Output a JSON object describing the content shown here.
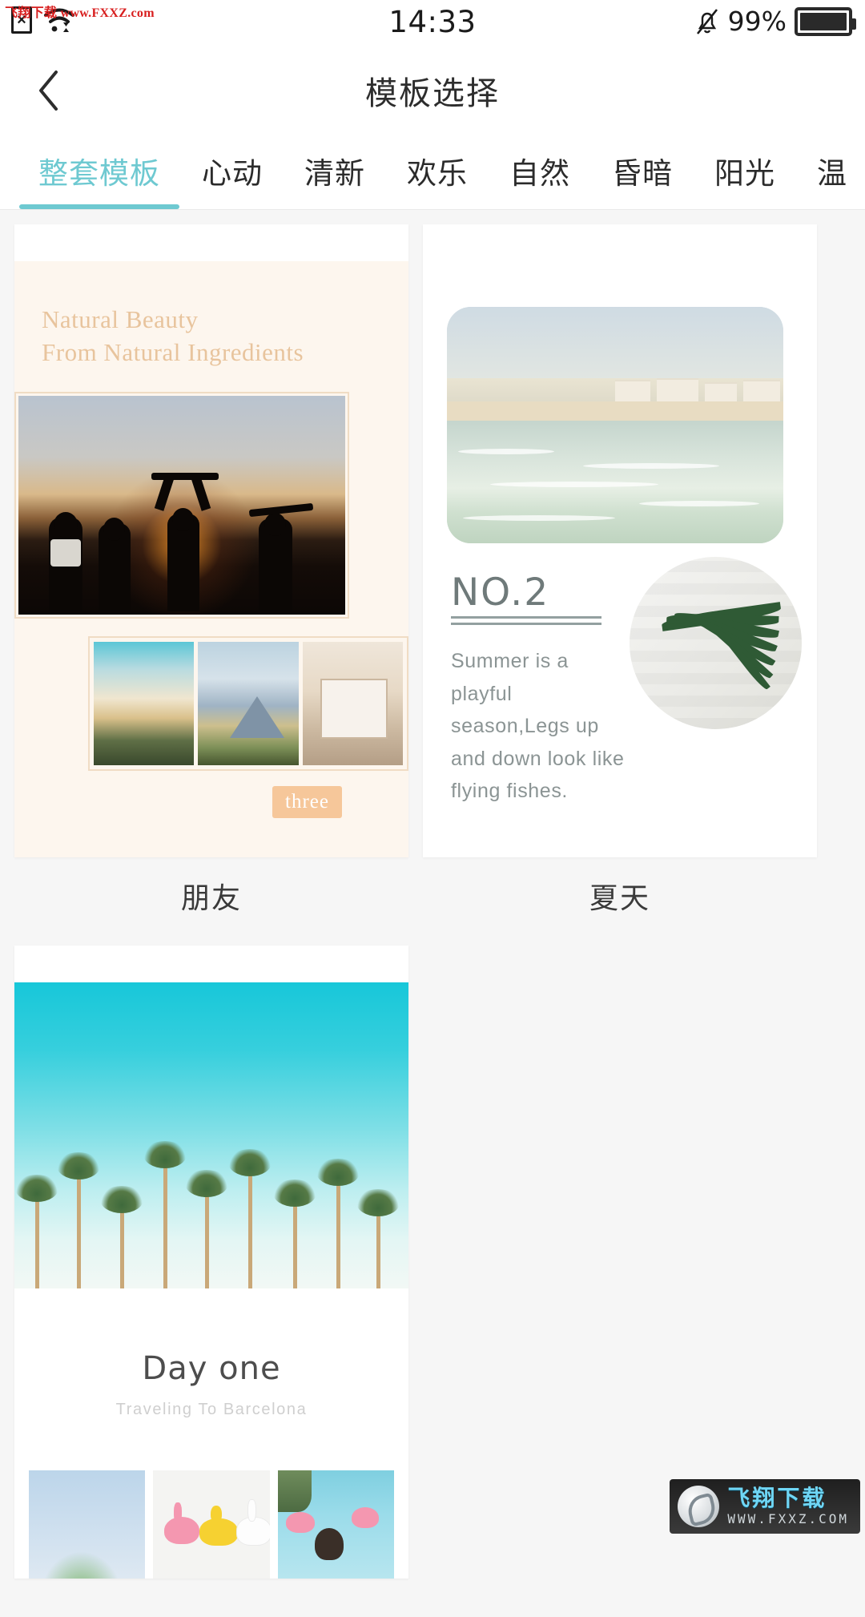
{
  "watermark": {
    "top_text": "飞翔下载 www.FXXZ.com",
    "bottom_cn": "飞翔下载",
    "bottom_en": "WWW.FXXZ.COM"
  },
  "statusbar": {
    "time": "14:33",
    "battery_percent": "99%",
    "sim_glyph": "×",
    "icons": [
      "sim-card-icon",
      "wifi-icon",
      "bell-muted-icon",
      "battery-icon"
    ]
  },
  "header": {
    "title": "模板选择",
    "back_icon": "chevron-left-icon"
  },
  "tabs": {
    "active_index": 0,
    "accent_color": "#6ec9d1",
    "items": [
      {
        "label": "整套模板"
      },
      {
        "label": "心动"
      },
      {
        "label": "清新"
      },
      {
        "label": "欢乐"
      },
      {
        "label": "自然"
      },
      {
        "label": "昏暗"
      },
      {
        "label": "阳光"
      },
      {
        "label": "温"
      }
    ]
  },
  "templates": [
    {
      "label": "朋友",
      "title_line1": "Natural Beauty",
      "title_line2": "From Natural Ingredients",
      "badge": "three",
      "title_color": "#e8c49d",
      "background_color": "#fdf6ee"
    },
    {
      "label": "夏天",
      "number": "NO.2",
      "description": "Summer is a playful season,Legs up and down look like flying fishes.",
      "text_color": "#8b9494",
      "background_color": "#ffffff"
    },
    {
      "label": "",
      "title": "Day one",
      "subtitle": "Traveling To Barcelona",
      "title_color": "#4d4d4d",
      "background_color": "#ffffff"
    }
  ]
}
